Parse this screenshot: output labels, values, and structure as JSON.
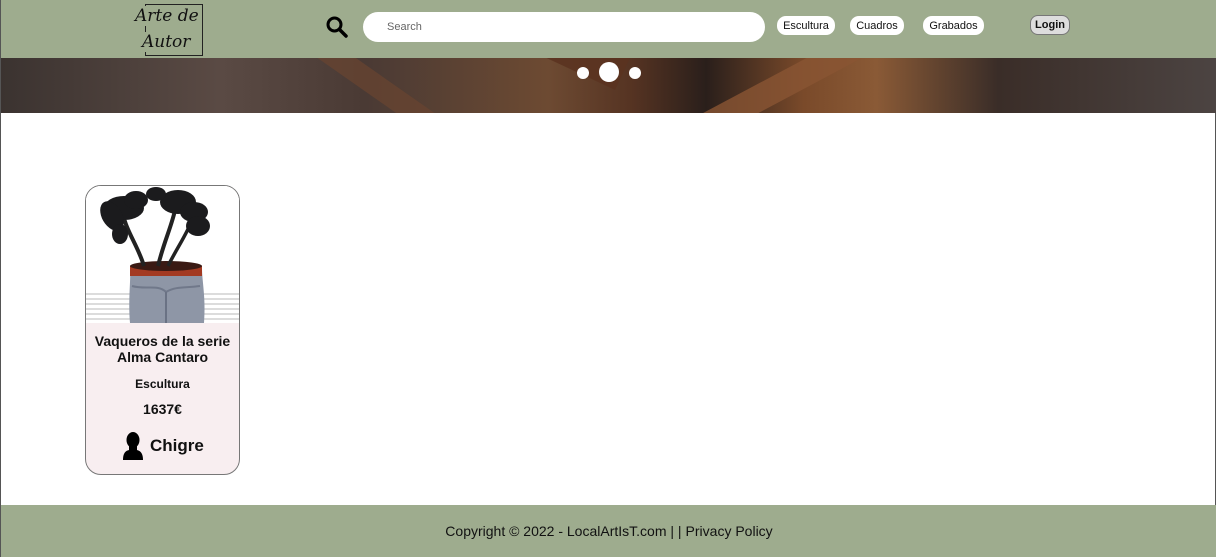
{
  "header": {
    "logo_line1": "Arte de",
    "logo_line2": "Autor",
    "search": {
      "placeholder": "Search",
      "value": ""
    },
    "nav": [
      {
        "label": "Escultura"
      },
      {
        "label": "Cuadros"
      },
      {
        "label": "Grabados"
      }
    ],
    "login_label": "Login",
    "icons": {
      "search": "search-icon"
    }
  },
  "carousel": {
    "slides": 3,
    "active_index": 1
  },
  "products": [
    {
      "title": "Vaqueros de la serie Alma Cantaro",
      "category": "Escultura",
      "price": "1637€",
      "artist": "Chigre",
      "artist_icon": "person-silhouette-icon"
    }
  ],
  "footer": {
    "copyright": "Copyright © 2022 - LocalArtIsT.com | |",
    "privacy_label": "Privacy Policy"
  },
  "colors": {
    "header_bg": "#9eac8e",
    "footer_bg": "#9eac8e",
    "card_bg": "#f8eef0"
  }
}
